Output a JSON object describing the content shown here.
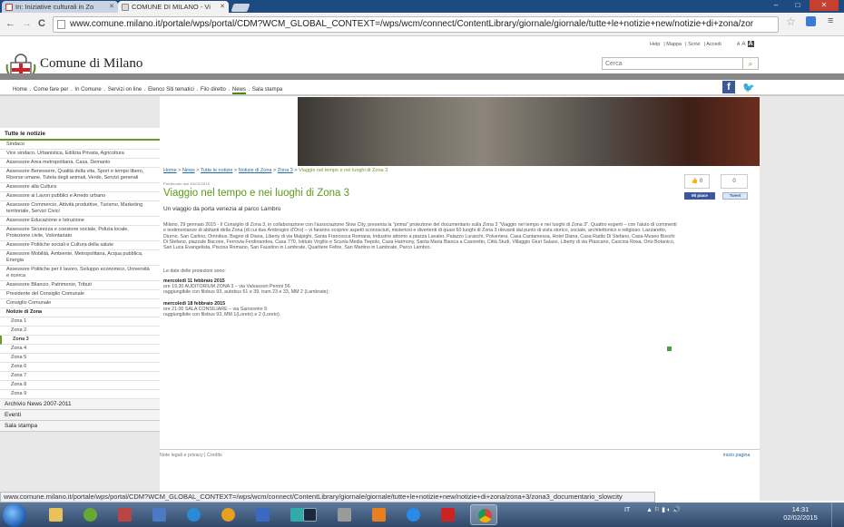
{
  "browser": {
    "tabs": [
      {
        "title": "In: Iniziative culturali in Zo",
        "icon": "gmail-icon"
      },
      {
        "title": "COMUNE DI MILANO - Vi",
        "icon": "milano-favicon"
      }
    ],
    "url": "www.comune.milano.it/portale/wps/portal/CDM?WCM_GLOBAL_CONTEXT=/wps/wcm/connect/ContentLibrary/giornale/giornale/tutte+le+notizie+new/notizie+di+zona/zor",
    "back": "←",
    "forward": "→",
    "reload": "C",
    "star": "☆",
    "menu": "≡",
    "min": "–",
    "max": "□",
    "close": "✕",
    "status": "www.comune.milano.it/portale/wps/portal/CDM?WCM_GLOBAL_CONTEXT=/wps/wcm/connect/ContentLibrary/giornale/giornale/tutte+le+notizie+new/notizie+di+zona/zona+3/zona3_documentario_slowcity"
  },
  "header": {
    "utility": [
      "Help",
      "Mappa",
      "Scrivi",
      "Accedi"
    ],
    "font_small": "A",
    "font_mid": "A",
    "font_large": "A",
    "logo_text": "Comune di Milano",
    "search_placeholder": "Cerca",
    "search_icon": "magnifier-icon"
  },
  "nav": {
    "items": [
      "Home",
      "Come fare per",
      "In Comune",
      "Servizi on line",
      "Elenco Siti tematici",
      "Filo diretto",
      "News",
      "Sala stampa"
    ],
    "sep": "."
  },
  "social": {
    "fb": "f",
    "tw": "🐦"
  },
  "sidebar": {
    "head": "Tutte le notizie",
    "items": [
      "Sindaco",
      "Vice sindaco, Urbanistica, Edilizia Privata, Agricoltura",
      "Assessore Area metropolitana, Casa, Demanio",
      "Assessore Benessere, Qualità della vita, Sport e tempo libero, Risorse umane, Tutela degli animali, Verde, Servizi generali",
      "Assessore alla Cultura",
      "Assessore ai Lavori pubblici e Arredo urbano",
      "Assessore Commercio, Attività produttive, Turismo, Marketing territoriale, Servizi Civici",
      "Assessore Educazione e Istruzione",
      "Assessore Sicurezza e coesione sociale, Polizia locale, Protezione civile, Volontariato",
      "Assessore Politiche sociali e Cultura della salute",
      "Assessore Mobilità, Ambiente, Metropolitana, Acqua pubblica, Energia",
      "Assessore Politiche per il lavoro, Sviluppo economico, Università e ricerca",
      "Assessore Bilancio, Patrimonio, Tributi",
      "Presidente del Consiglio Comunale",
      "Consiglio Comunale"
    ],
    "zona_head": "Notizie di Zona",
    "zone": [
      "Zona 1",
      "Zona 2",
      "Zona 3",
      "Zona 4",
      "Zona 5",
      "Zona 6",
      "Zona 7",
      "Zona 8",
      "Zona 9"
    ],
    "sections": [
      "Archivio News 2007-2011",
      "Eventi",
      "Sala stampa"
    ]
  },
  "article": {
    "breadcrumb": [
      "Home",
      "News",
      "Tutte le notizie",
      "Notizie di Zona",
      "Zona 3"
    ],
    "breadcrumb_current": "Viaggio nel tempo e nei luoghi di Zona 3",
    "sep": " > ",
    "publish": "Pubblicato dal 10/02/2015",
    "title": "Viaggio nel tempo e nei luoghi di Zona 3",
    "subtitle": "Un viaggio da porta venezia al parco Lambro",
    "like_count": "0",
    "share_count": "0",
    "like_label": "👍 0",
    "fb_label": "Mi piace",
    "tweet_label": "Tweet",
    "body": "Milano, 29 gennaio 2015 - Il Consiglio di Zona 3, in collaborazione con l'associazione Slow City, presenta la \"prima\" proiezione del documentario sulla Zona 3 \"Viaggio nel tempo e nei luoghi di Zona 3\". Quattro esperti – con l'aiuto di commenti e testimonianze di abitanti della Zona (di cui due Ambrogini d'Oro) – vi faranno scoprire aspetti sconosciuti, misteriosi e divertenti di quasi 60 luoghi di Zona 3 rilevanti dal punto di vista storico, sociale, architettonico e religioso: Lazzaretto, Diurno, San Carlino, Omnibus, Bagno di Diana, Liberty di via Malpighi, Santa Francesca Romana, Industrie attorno a piazza Lavater, Palazzo Luraschi, Polveriera, Casa Cantamessa, Hotel Diana, Casa Radio Di Stefano, Casa-Museo Boschi Di Stefano, piazzale Bacone, Ferrovia Ferdinandea, Casa 770, Istituto Virgilio e Scuola Media Tiepolo, Casa Harmony, Santa Maria Bianca a Casoretto, Città Studi, Villaggio Giuri Salaso, Liberty di via Plascano, Cascina Rosa, Orto Botanico, San Luca Evangelista, Piscina Romano, San Faustino in Lambrate, Quartiere Feltre, San Martino in Lambrate, Parco Lambro.",
    "dates_intro": "Le date delle proiezioni sono:",
    "events": [
      {
        "date": "mercoledì 11 febbraio 2015",
        "line1": "ore 19.30 AUDITORIUM ZONA 3 – via Valvassori Peroni 56",
        "line2": "raggiungibile con filobus 93, autobus 61 e 39, tram 23 e 33, MM 2 (Lambrate);"
      },
      {
        "date": "mercoledì 18 febbraio 2015",
        "line1": "ore 21.00 SALA CONSILIARE – via Sansovino 9",
        "line2": "raggiungibile con filobus 93, MM 1(Loreto) e 2 (Loreto)."
      }
    ]
  },
  "footer": {
    "left": "Note legali e privacy | Credits",
    "right": "inizio pagina"
  },
  "taskbar": {
    "lang": "IT",
    "tray": "▲ ⚐ ▮ ◐ 🔊",
    "time": "14:31",
    "date": "02/02/2015"
  }
}
